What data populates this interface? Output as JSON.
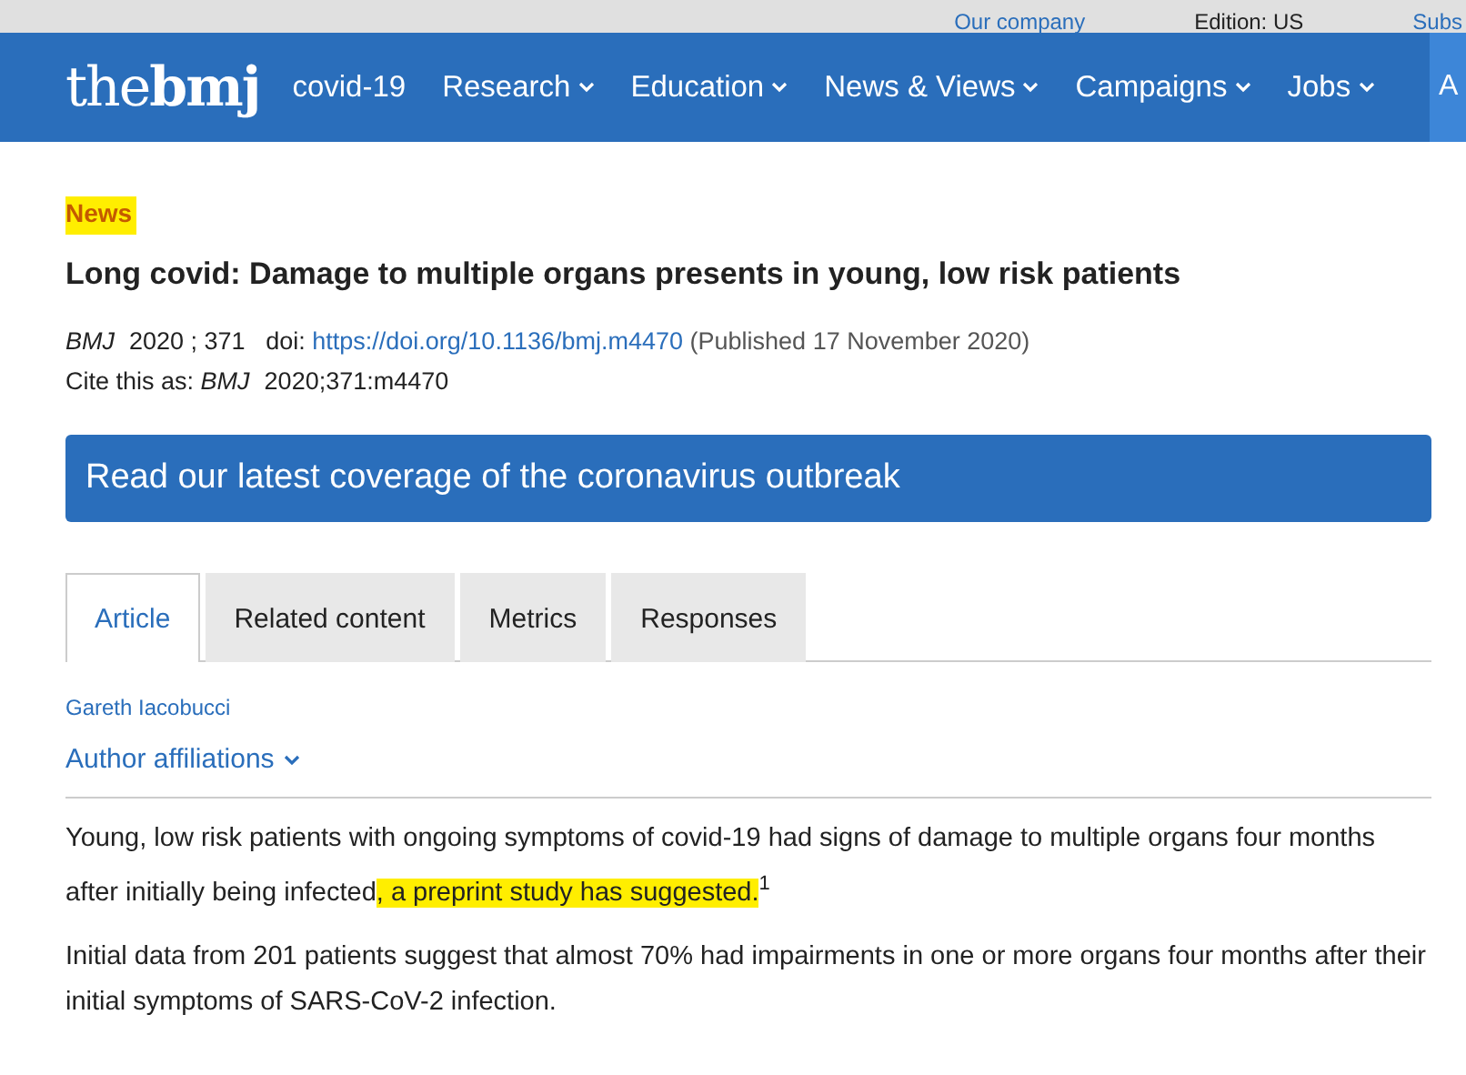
{
  "top_links": [
    {
      "label": "Our company"
    },
    {
      "label": "Edition: US",
      "kind": "plain"
    },
    {
      "label": "Subs"
    }
  ],
  "logo": {
    "light": "the",
    "bold": "bmj"
  },
  "nav": [
    {
      "label": "covid-19",
      "dropdown": false
    },
    {
      "label": "Research",
      "dropdown": true
    },
    {
      "label": "Education",
      "dropdown": true
    },
    {
      "label": "News & Views",
      "dropdown": true
    },
    {
      "label": "Campaigns",
      "dropdown": true
    },
    {
      "label": "Jobs",
      "dropdown": true
    }
  ],
  "nav_cut": "A",
  "section": {
    "label": "News",
    "highlighted": true
  },
  "title": "Long covid: Damage to multiple organs presents in young, low risk patients",
  "citation": {
    "journal": "BMJ",
    "volume": "2020 ; 371",
    "doi_label": "doi:",
    "doi": "https://doi.org/10.1136/bmj.m4470",
    "published": "(Published 17 November 2020)",
    "cite_label": "Cite this as:",
    "cite_journal": "BMJ",
    "cite_ref": "2020;371:m4470"
  },
  "banner": "Read our latest coverage of the coronavirus outbreak",
  "tabs": [
    {
      "label": "Article",
      "selected": true
    },
    {
      "label": "Related content",
      "selected": false
    },
    {
      "label": "Metrics",
      "selected": false
    },
    {
      "label": "Responses",
      "selected": false
    }
  ],
  "author": "Gareth Iacobucci",
  "affiliations": {
    "label": "Author affiliations",
    "expanded": false
  },
  "paragraphs": [
    [
      {
        "text": "Young, low risk patients with ongoing symptoms of covid-19 had signs of damage to multiple organs four months after initially being infected",
        "highlighted": false
      },
      {
        "text": ", a preprint study has suggested.",
        "highlighted": true
      },
      {
        "text": "$^{1}$",
        "highlighted": false
      }
    ],
    [
      {
        "text": "Initial data from 201 patients suggest that almost 70% had impairments in one or more organs four months after their initial symptoms of SARS-CoV-2 infection.",
        "highlighted": false
      }
    ]
  ]
}
